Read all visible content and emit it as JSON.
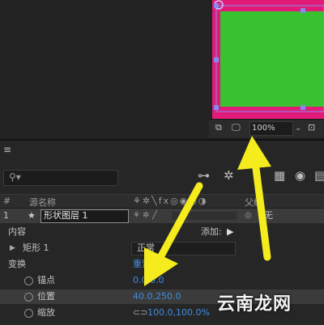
{
  "viewer": {
    "zoom": "100%",
    "zoom_dropdown_icon": "chevron-down-icon",
    "shape_fill_color": "#38c232",
    "shape_stroke_color": "#e31b78",
    "selection_handle_color": "#8888ee"
  },
  "timeline": {
    "menu_icon": "hamburger-menu-icon",
    "search_placeholder": "",
    "header": {
      "hash": "#",
      "source_name": "源名称",
      "parent": "父级"
    },
    "layer": {
      "number": "1",
      "name": "形状图层 1",
      "parent_value": "无"
    },
    "contents": {
      "label": "内容",
      "add_label": "添加:"
    },
    "rectangle": {
      "label": "矩形 1",
      "blend_mode": "正常"
    },
    "transform": {
      "label": "变换",
      "reset_label": "重置"
    },
    "anchor": {
      "label": "锚点",
      "value": "0.0,0.0"
    },
    "position": {
      "label": "位置",
      "value": "40.0,250.0"
    },
    "scale": {
      "label": "缩放",
      "value": "100.0,100.0%"
    }
  },
  "annotation": {
    "arrow_color": "#f5ec1e"
  },
  "watermark": "云南龙网"
}
